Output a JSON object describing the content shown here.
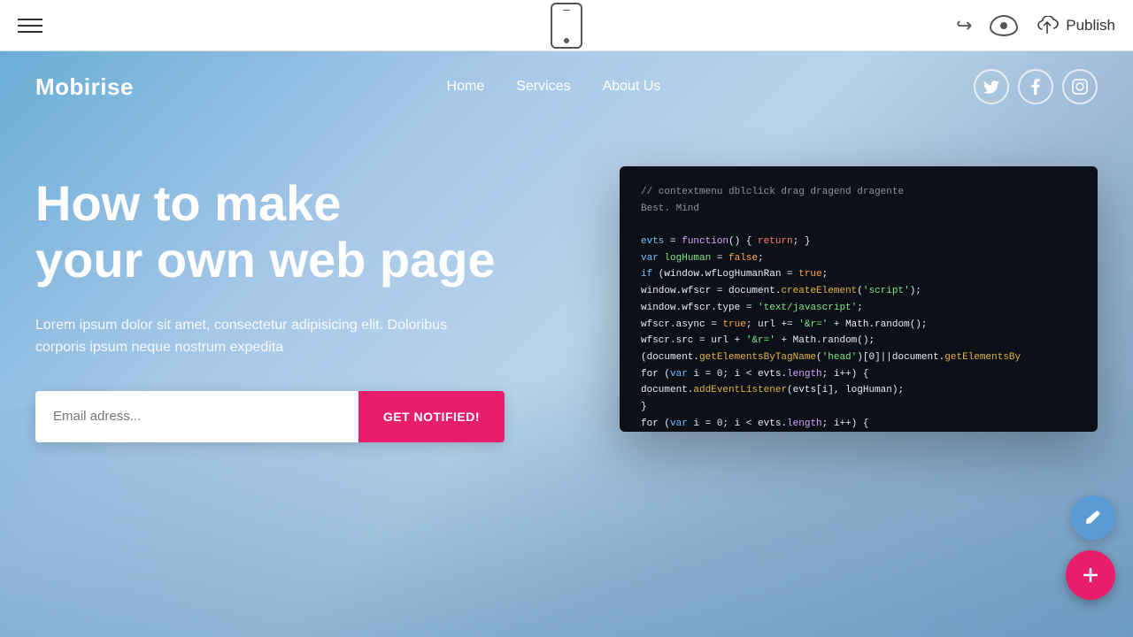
{
  "toolbar": {
    "publish_label": "Publish"
  },
  "site": {
    "logo": "Mobirise",
    "nav": {
      "links": [
        {
          "label": "Home"
        },
        {
          "label": "Services"
        },
        {
          "label": "About Us"
        }
      ]
    },
    "social": [
      {
        "icon": "T",
        "label": "twitter-icon"
      },
      {
        "icon": "f",
        "label": "facebook-icon"
      },
      {
        "icon": "I",
        "label": "instagram-icon"
      }
    ]
  },
  "hero": {
    "title_line1": "How to make",
    "title_line2": "your own web page",
    "subtitle": "Lorem ipsum dolor sit amet, consectetur adipisicing elit. Doloribus corporis ipsum neque nostrum expedita",
    "email_placeholder": "Email adress...",
    "cta_label": "GET NOTIFIED!"
  }
}
